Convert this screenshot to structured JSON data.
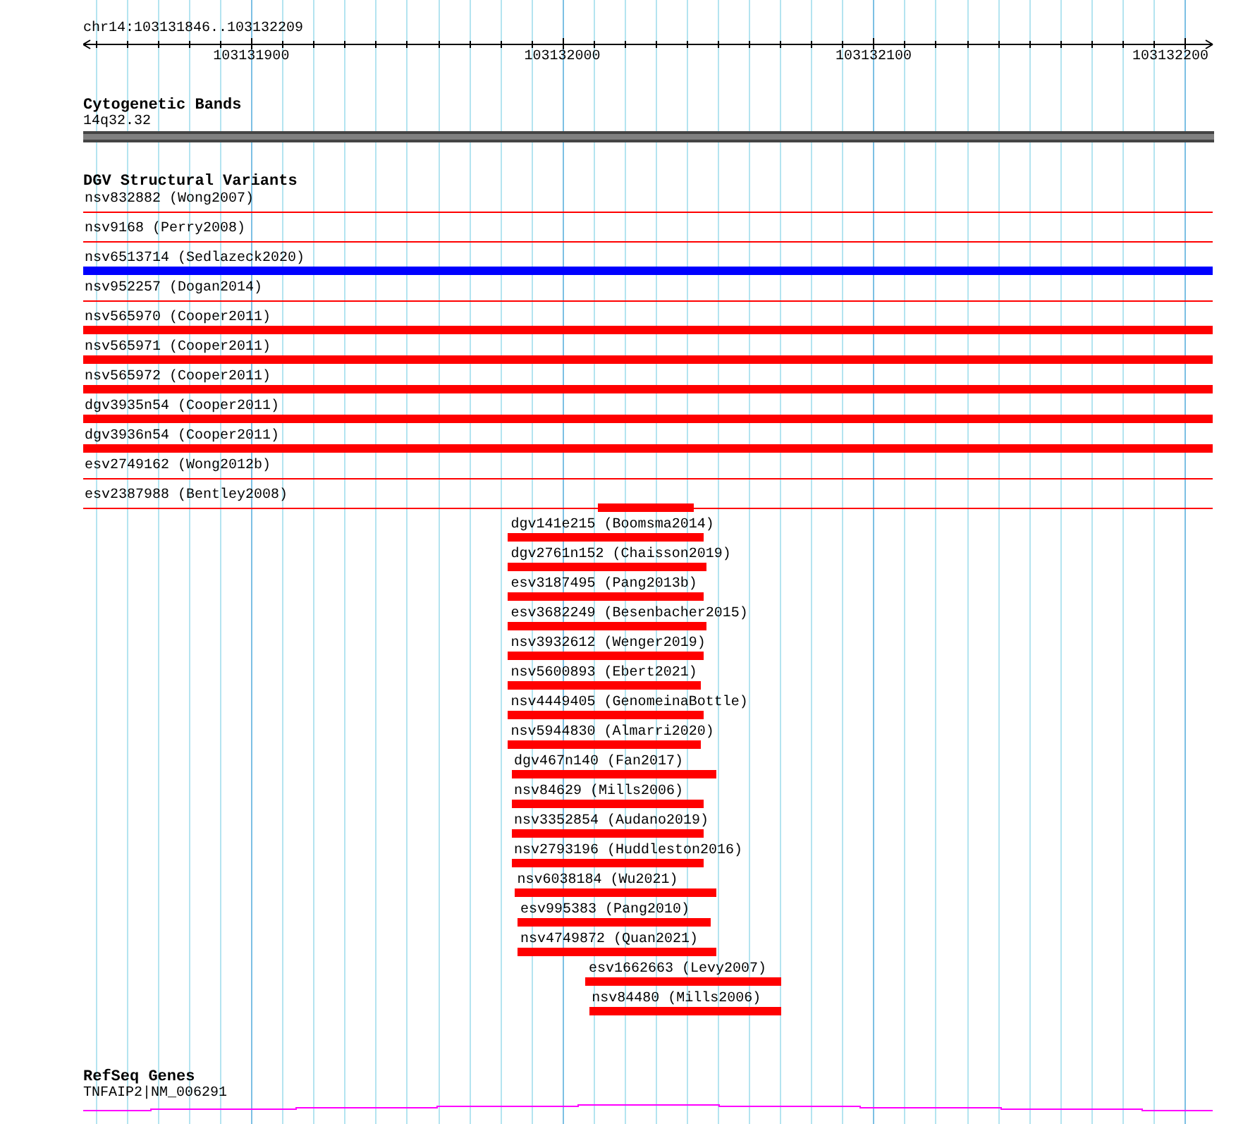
{
  "ruler": {
    "location": "chr14:103131846..103132209",
    "ticks": [
      {
        "label": "103131900",
        "level": 0.1488
      },
      {
        "label": "103132000",
        "level": 0.4242
      },
      {
        "label": "103132100",
        "level": 0.6997
      },
      {
        "label": "103132200",
        "level": 0.9752
      }
    ]
  },
  "cytogenetic_bands": {
    "title": "Cytogenetic Bands",
    "band": "14q32.32"
  },
  "dgv": {
    "title": "DGV Structural Variants",
    "variants": [
      {
        "label": "nsv832882 (Wong2007)",
        "baseline": true,
        "color": "#ff0000"
      },
      {
        "label": "nsv9168 (Perry2008)",
        "baseline": true,
        "color": "#ff0000"
      },
      {
        "label": "nsv6513714 (Sedlazeck2020)",
        "baseline": false,
        "color": "#0000ff",
        "kind": "full"
      },
      {
        "label": "nsv952257 (Dogan2014)",
        "baseline": true,
        "color": "#ff0000"
      },
      {
        "label": "nsv565970 (Cooper2011)",
        "baseline": false,
        "color": "#ff0000",
        "kind": "full"
      },
      {
        "label": "nsv565971 (Cooper2011)",
        "baseline": false,
        "color": "#ff0000",
        "kind": "full"
      },
      {
        "label": "nsv565972 (Cooper2011)",
        "baseline": false,
        "color": "#ff0000",
        "kind": "full"
      },
      {
        "label": "dgv3935n54 (Cooper2011)",
        "baseline": false,
        "color": "#ff0000",
        "kind": "full"
      },
      {
        "label": "dgv3936n54 (Cooper2011)",
        "baseline": false,
        "color": "#ff0000",
        "kind": "full"
      },
      {
        "label": "esv2749162 (Wong2012b)",
        "baseline": true,
        "color": "#ff0000"
      },
      {
        "label": "esv2387988 (Bentley2008)",
        "baseline": true,
        "color": "#ff0000",
        "from": {
          "level": 0.4573
        },
        "to": {
          "level": 0.5399
        }
      },
      {
        "label": "dgv141e215 (Boomsma2014)",
        "baseline": false,
        "color": "#ff0000",
        "from": {
          "level": 0.3774
        },
        "to": {
          "level": 0.5482
        }
      },
      {
        "label": "dgv2761n152 (Chaisson2019)",
        "baseline": false,
        "color": "#ff0000",
        "from": {
          "level": 0.3774
        },
        "to": {
          "level": 0.551
        }
      },
      {
        "label": "esv3187495 (Pang2013b)",
        "baseline": false,
        "color": "#ff0000",
        "from": {
          "level": 0.3774
        },
        "to": {
          "level": 0.5482
        }
      },
      {
        "label": "esv3682249 (Besenbacher2015)",
        "baseline": false,
        "color": "#ff0000",
        "from": {
          "level": 0.3774
        },
        "to": {
          "level": 0.551
        }
      },
      {
        "label": "nsv3932612 (Wenger2019)",
        "baseline": false,
        "color": "#ff0000",
        "from": {
          "level": 0.3774
        },
        "to": {
          "level": 0.5482
        }
      },
      {
        "label": "nsv5600893 (Ebert2021)",
        "baseline": false,
        "color": "#ff0000",
        "from": {
          "level": 0.3774
        },
        "to": {
          "level": 0.5455
        }
      },
      {
        "label": "nsv4449405 (GenomeinaBottle)",
        "baseline": false,
        "color": "#ff0000",
        "from": {
          "level": 0.3774
        },
        "to": {
          "level": 0.5482
        }
      },
      {
        "label": "nsv5944830 (Almarri2020)",
        "baseline": false,
        "color": "#ff0000",
        "from": {
          "level": 0.3774
        },
        "to": {
          "level": 0.5455
        }
      },
      {
        "label": "dgv467n140 (Fan2017)",
        "baseline": false,
        "color": "#ff0000",
        "from": {
          "level": 0.3802
        },
        "to": {
          "level": 0.5592
        }
      },
      {
        "label": "nsv84629 (Mills2006)",
        "baseline": false,
        "color": "#ff0000",
        "from": {
          "level": 0.3802
        },
        "to": {
          "level": 0.5482
        }
      },
      {
        "label": "nsv3352854 (Audano2019)",
        "baseline": false,
        "color": "#ff0000",
        "from": {
          "level": 0.3802
        },
        "to": {
          "level": 0.5482
        }
      },
      {
        "label": "nsv2793196 (Huddleston2016)",
        "baseline": false,
        "color": "#ff0000",
        "from": {
          "level": 0.3802
        },
        "to": {
          "level": 0.5482
        }
      },
      {
        "label": "nsv6038184 (Wu2021)",
        "baseline": false,
        "color": "#ff0000",
        "from": {
          "level": 0.3829
        },
        "to": {
          "level": 0.5592
        }
      },
      {
        "label": "esv995383 (Pang2010)",
        "baseline": false,
        "color": "#ff0000",
        "from": {
          "level": 0.3857
        },
        "to": {
          "level": 0.5537
        }
      },
      {
        "label": "nsv4749872 (Quan2021)",
        "baseline": false,
        "color": "#ff0000",
        "from": {
          "level": 0.3857
        },
        "to": {
          "level": 0.5592
        }
      },
      {
        "label": "esv1662663 (Levy2007)",
        "baseline": false,
        "color": "#ff0000",
        "from": {
          "level": 0.4463
        },
        "to": {
          "level": 0.6171
        }
      },
      {
        "label": "nsv84480 (Mills2006)",
        "baseline": false,
        "color": "#ff0000",
        "from": {
          "level": 0.449
        },
        "to": {
          "level": 0.6171
        }
      }
    ]
  },
  "refseq_genes": {
    "title": "RefSeq Genes",
    "gene": "TNFAIP2|NM_006291"
  }
}
